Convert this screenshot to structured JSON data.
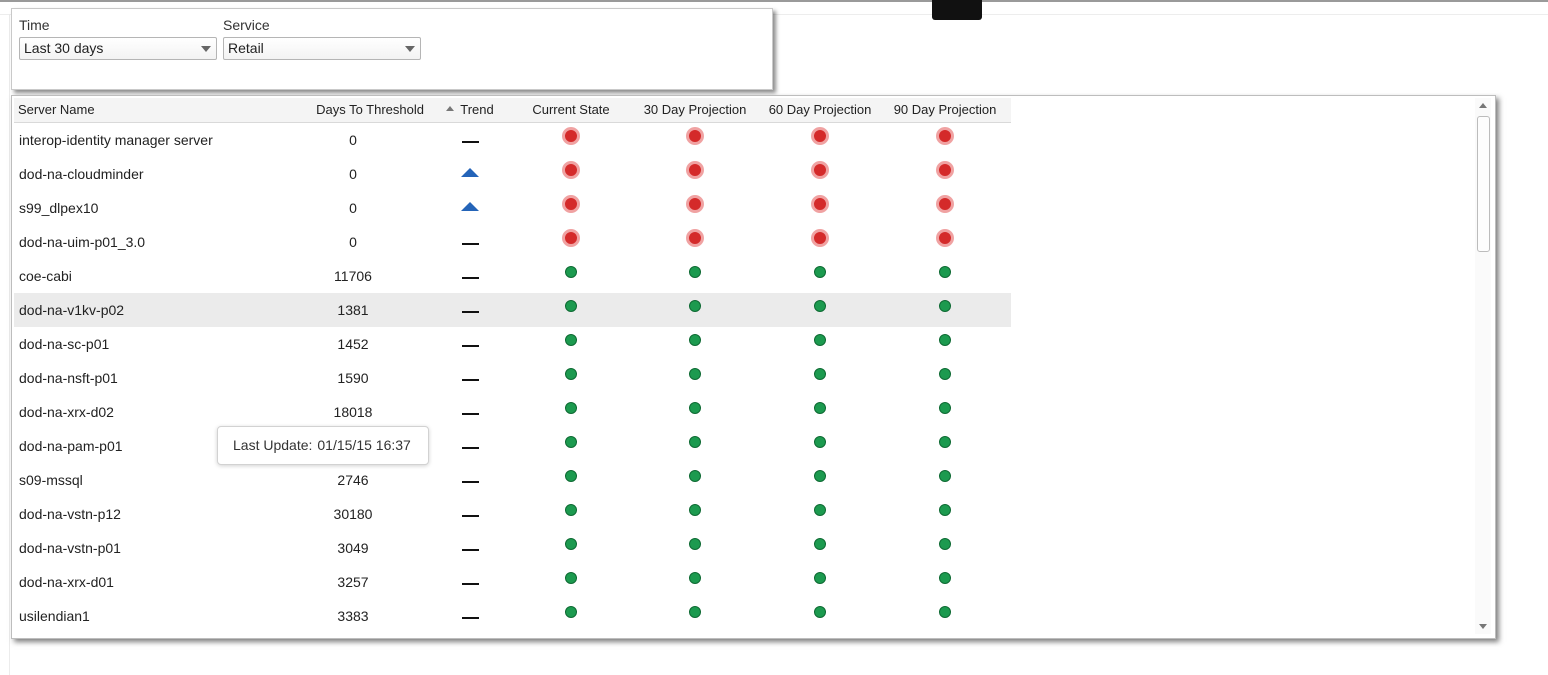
{
  "filters": {
    "time": {
      "label": "Time",
      "value": "Last 30 days"
    },
    "service": {
      "label": "Service",
      "value": "Retail"
    }
  },
  "table": {
    "headers": {
      "server_name": "Server Name",
      "days_to_threshold": "Days To Threshold",
      "trend": "Trend",
      "current_state": "Current State",
      "projection_30": "30 Day Projection",
      "projection_60": "60 Day Projection",
      "projection_90": "90 Day Projection"
    },
    "sorted_by": "trend",
    "sort_direction": "ascending",
    "rows": [
      {
        "name": "interop-identity manager server",
        "days": "0",
        "trend": "flat",
        "current": "red",
        "p30": "red",
        "p60": "red",
        "p90": "red"
      },
      {
        "name": "dod-na-cloudminder",
        "days": "0",
        "trend": "up",
        "current": "red",
        "p30": "red",
        "p60": "red",
        "p90": "red"
      },
      {
        "name": "s99_dlpex10",
        "days": "0",
        "trend": "up",
        "current": "red",
        "p30": "red",
        "p60": "red",
        "p90": "red"
      },
      {
        "name": "dod-na-uim-p01_3.0",
        "days": "0",
        "trend": "flat",
        "current": "red",
        "p30": "red",
        "p60": "red",
        "p90": "red"
      },
      {
        "name": "coe-cabi",
        "days": "11706",
        "trend": "flat",
        "current": "green",
        "p30": "green",
        "p60": "green",
        "p90": "green"
      },
      {
        "name": "dod-na-v1kv-p02",
        "days": "1381",
        "trend": "flat",
        "current": "green",
        "p30": "green",
        "p60": "green",
        "p90": "green",
        "selected": true
      },
      {
        "name": "dod-na-sc-p01",
        "days": "1452",
        "trend": "flat",
        "current": "green",
        "p30": "green",
        "p60": "green",
        "p90": "green"
      },
      {
        "name": "dod-na-nsft-p01",
        "days": "1590",
        "trend": "flat",
        "current": "green",
        "p30": "green",
        "p60": "green",
        "p90": "green"
      },
      {
        "name": "dod-na-xrx-d02",
        "days": "18018",
        "trend": "flat",
        "current": "green",
        "p30": "green",
        "p60": "green",
        "p90": "green"
      },
      {
        "name": "dod-na-pam-p01",
        "days": "",
        "trend": "flat",
        "current": "green",
        "p30": "green",
        "p60": "green",
        "p90": "green"
      },
      {
        "name": "s09-mssql",
        "days": "2746",
        "trend": "flat",
        "current": "green",
        "p30": "green",
        "p60": "green",
        "p90": "green"
      },
      {
        "name": "dod-na-vstn-p12",
        "days": "30180",
        "trend": "flat",
        "current": "green",
        "p30": "green",
        "p60": "green",
        "p90": "green"
      },
      {
        "name": "dod-na-vstn-p01",
        "days": "3049",
        "trend": "flat",
        "current": "green",
        "p30": "green",
        "p60": "green",
        "p90": "green"
      },
      {
        "name": "dod-na-xrx-d01",
        "days": "3257",
        "trend": "flat",
        "current": "green",
        "p30": "green",
        "p60": "green",
        "p90": "green"
      },
      {
        "name": "usilendian1",
        "days": "3383",
        "trend": "flat",
        "current": "green",
        "p30": "green",
        "p60": "green",
        "p90": "green"
      }
    ]
  },
  "tooltip": {
    "label": "Last Update:",
    "value": "01/15/15 16:37"
  },
  "colors": {
    "status_red": "#d42a2a",
    "status_green": "#1c9a4f",
    "trend_up": "#2464b8",
    "selected_row": "#ebebeb"
  }
}
